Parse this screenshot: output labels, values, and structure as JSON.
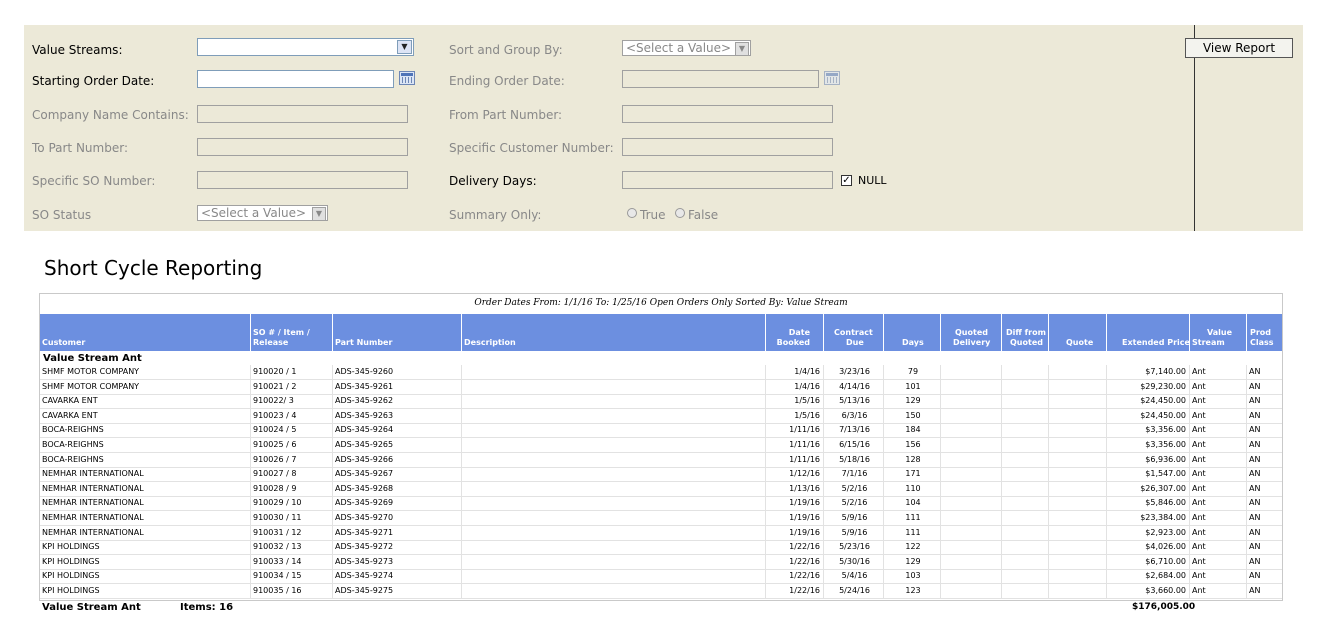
{
  "params": {
    "value_streams_label": "Value Streams:",
    "starting_order_date_label": "Starting Order Date:",
    "company_name_label": "Company Name Contains:",
    "to_part_label": "To Part Number:",
    "specific_so_label": "Specific SO Number:",
    "so_status_label": "SO Status",
    "so_status_value": "<Select a Value>",
    "sort_group_label": "Sort and Group By:",
    "sort_group_value": "<Select a Value>",
    "ending_order_date_label": "Ending Order Date:",
    "from_part_label": "From Part Number:",
    "specific_customer_label": "Specific Customer Number:",
    "delivery_days_label": "Delivery Days:",
    "null_label": "NULL",
    "summary_only_label": "Summary Only:",
    "true_label": "True",
    "false_label": "False",
    "view_report": "View Report"
  },
  "report": {
    "title": "Short Cycle Reporting",
    "subtitle": "Order Dates From: 1/1/16 To: 1/25/16   Open Orders Only   Sorted By: Value Stream",
    "columns": {
      "customer": "Customer",
      "so_top": "SO # / Item /",
      "so_bottom": "Release",
      "part": "Part Number",
      "desc": "Description",
      "date_top": "Date",
      "date_bottom": "Booked",
      "contract_top": "Contract",
      "contract_bottom": "Due",
      "days": "Days",
      "quoted_top": "Quoted",
      "quoted_bottom": "Delivery",
      "diff_top": "Diff from",
      "diff_bottom": "Quoted",
      "quote": "Quote",
      "ext": "Extended Price",
      "vs_top": "Value",
      "vs_bottom": "Stream",
      "pc_top": "Prod",
      "pc_bottom": "Class"
    },
    "group_label": "Value Stream  Ant",
    "rows": [
      {
        "customer": "SHMF MOTOR COMPANY",
        "so": "910020 /  1",
        "part": "ADS-345-9260",
        "booked": "1/4/16",
        "due": "3/23/16",
        "days": "79",
        "price": "$7,140.00",
        "stream": "Ant",
        "cls": "AN"
      },
      {
        "customer": "SHMF MOTOR COMPANY",
        "so": "910021 /  2",
        "part": "ADS-345-9261",
        "booked": "1/4/16",
        "due": "4/14/16",
        "days": "101",
        "price": "$29,230.00",
        "stream": "Ant",
        "cls": "AN"
      },
      {
        "customer": "CAVARKA ENT",
        "so": "910022/  3",
        "part": "ADS-345-9262",
        "booked": "1/5/16",
        "due": "5/13/16",
        "days": "129",
        "price": "$24,450.00",
        "stream": "Ant",
        "cls": "AN"
      },
      {
        "customer": "CAVARKA ENT",
        "so": "910023 /  4",
        "part": "ADS-345-9263",
        "booked": "1/5/16",
        "due": "6/3/16",
        "days": "150",
        "price": "$24,450.00",
        "stream": "Ant",
        "cls": "AN"
      },
      {
        "customer": "BOCA-REIGHNS",
        "so": "910024 /  5",
        "part": "ADS-345-9264",
        "booked": "1/11/16",
        "due": "7/13/16",
        "days": "184",
        "price": "$3,356.00",
        "stream": "Ant",
        "cls": "AN"
      },
      {
        "customer": "BOCA-REIGHNS",
        "so": "910025 /  6",
        "part": "ADS-345-9265",
        "booked": "1/11/16",
        "due": "6/15/16",
        "days": "156",
        "price": "$3,356.00",
        "stream": "Ant",
        "cls": "AN"
      },
      {
        "customer": "BOCA-REIGHNS",
        "so": "910026 /  7",
        "part": "ADS-345-9266",
        "booked": "1/11/16",
        "due": "5/18/16",
        "days": "128",
        "price": "$6,936.00",
        "stream": "Ant",
        "cls": "AN"
      },
      {
        "customer": "NEMHAR INTERNATIONAL",
        "so": "910027 /  8",
        "part": "ADS-345-9267",
        "booked": "1/12/16",
        "due": "7/1/16",
        "days": "171",
        "price": "$1,547.00",
        "stream": "Ant",
        "cls": "AN"
      },
      {
        "customer": "NEMHAR INTERNATIONAL",
        "so": "910028 /  9",
        "part": "ADS-345-9268",
        "booked": "1/13/16",
        "due": "5/2/16",
        "days": "110",
        "price": "$26,307.00",
        "stream": "Ant",
        "cls": "AN"
      },
      {
        "customer": "NEMHAR INTERNATIONAL",
        "so": "910029 /  10",
        "part": "ADS-345-9269",
        "booked": "1/19/16",
        "due": "5/2/16",
        "days": "104",
        "price": "$5,846.00",
        "stream": "Ant",
        "cls": "AN"
      },
      {
        "customer": "NEMHAR INTERNATIONAL",
        "so": "910030 /  11",
        "part": "ADS-345-9270",
        "booked": "1/19/16",
        "due": "5/9/16",
        "days": "111",
        "price": "$23,384.00",
        "stream": "Ant",
        "cls": "AN"
      },
      {
        "customer": "NEMHAR INTERNATIONAL",
        "so": "910031 /  12",
        "part": "ADS-345-9271",
        "booked": "1/19/16",
        "due": "5/9/16",
        "days": "111",
        "price": "$2,923.00",
        "stream": "Ant",
        "cls": "AN"
      },
      {
        "customer": "KPI HOLDINGS",
        "so": "910032 /  13",
        "part": "ADS-345-9272",
        "booked": "1/22/16",
        "due": "5/23/16",
        "days": "122",
        "price": "$4,026.00",
        "stream": "Ant",
        "cls": "AN"
      },
      {
        "customer": "KPI HOLDINGS",
        "so": "910033 /  14",
        "part": "ADS-345-9273",
        "booked": "1/22/16",
        "due": "5/30/16",
        "days": "129",
        "price": "$6,710.00",
        "stream": "Ant",
        "cls": "AN"
      },
      {
        "customer": "KPI HOLDINGS",
        "so": "910034 /  15",
        "part": "ADS-345-9274",
        "booked": "1/22/16",
        "due": "5/4/16",
        "days": "103",
        "price": "$2,684.00",
        "stream": "Ant",
        "cls": "AN"
      },
      {
        "customer": "KPI HOLDINGS",
        "so": "910035 /  16",
        "part": "ADS-345-9275",
        "booked": "1/22/16",
        "due": "5/24/16",
        "days": "123",
        "price": "$3,660.00",
        "stream": "Ant",
        "cls": "AN"
      }
    ],
    "footer_stream": "Value Stream  Ant",
    "footer_items": "Items: 16",
    "footer_total": "$176,005.00"
  }
}
